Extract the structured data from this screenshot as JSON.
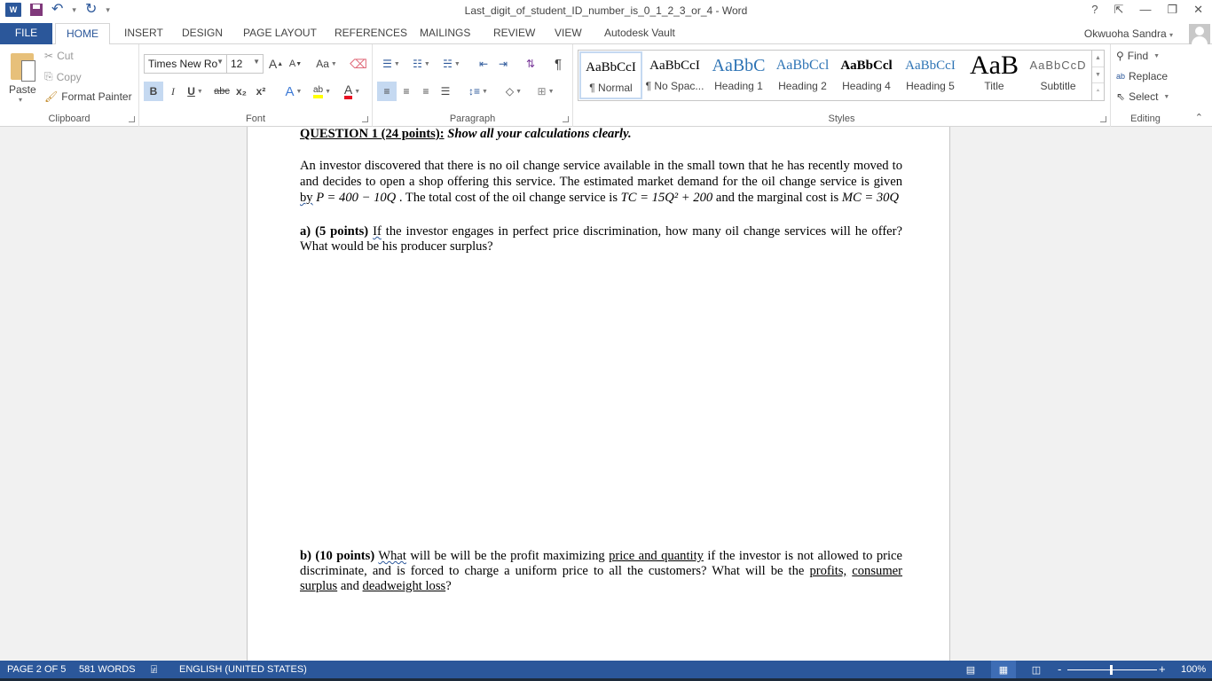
{
  "window": {
    "title": "Last_digit_of_student_ID_number_is_0_1_2_3_or_4 - Word",
    "controls": [
      "?",
      "⇱",
      "—",
      "❐",
      "✕"
    ]
  },
  "qat": {
    "undo": "↶",
    "redo": "↻",
    "customize": "⩡"
  },
  "tabs": [
    "FILE",
    "HOME",
    "INSERT",
    "DESIGN",
    "PAGE LAYOUT",
    "REFERENCES",
    "MAILINGS",
    "REVIEW",
    "VIEW",
    "Autodesk Vault"
  ],
  "active_tab": "HOME",
  "user": {
    "name": "Okwuoha Sandra"
  },
  "ribbon": {
    "clipboard": {
      "label": "Clipboard",
      "paste": "Paste",
      "cut": "Cut",
      "copy": "Copy",
      "format_painter": "Format Painter"
    },
    "font": {
      "label": "Font",
      "font_name": "Times New Ro",
      "font_size": "12",
      "grow": "A",
      "shrink": "A",
      "change_case": "Aa",
      "bold": "B",
      "italic": "I",
      "underline": "U",
      "strike": "abc",
      "subscript": "x₂",
      "superscript": "x²",
      "text_effects": "A",
      "highlight": "ab",
      "font_color": "A",
      "highlight_color": "#ffff00",
      "font_color_value": "#e81123"
    },
    "paragraph": {
      "label": "Paragraph",
      "pilcrow": "¶"
    },
    "styles": {
      "label": "Styles",
      "items": [
        {
          "preview": "AaBbCcI",
          "name": "¶ Normal",
          "selected": true
        },
        {
          "preview": "AaBbCcI",
          "name": "¶ No Spac..."
        },
        {
          "preview": "AaBbC",
          "name": "Heading 1"
        },
        {
          "preview": "AaBbCcl",
          "name": "Heading 2"
        },
        {
          "preview": "AaBbCcl",
          "name": "Heading 4"
        },
        {
          "preview": "AaBbCcI",
          "name": "Heading 5"
        },
        {
          "preview": "AaB",
          "name": "Title"
        },
        {
          "preview": "AaBbCcD",
          "name": "Subtitle"
        }
      ]
    },
    "editing": {
      "label": "Editing",
      "find": "Find",
      "replace": "Replace",
      "select": "Select"
    }
  },
  "document": {
    "question_heading": "QUESTION 1 (24 points):",
    "question_sub": " Show all your calculations clearly.",
    "intro_text": "An investor discovered that there is no oil change service available in the small town that he has recently moved to and decides to open a shop offering this service. The estimated market demand for the oil change service is given ",
    "intro_by": "by",
    "demand_eq": "P = 400 − 10Q",
    "tc_lead": " . The total cost of the oil change service is ",
    "tc_eq": "TC = 15Q² + 200",
    "mc_lead": " and the marginal cost is ",
    "mc_eq": "MC = 30Q",
    "part_a_label": "a) (5 points)",
    "part_a_if": "If",
    "part_a_text": " the investor engages in perfect price discrimination, how many oil change services will he offer? What would be his producer surplus?",
    "part_b_label": "b) (10 points)",
    "part_b_what": "What",
    "part_b_t1": " will be will be the profit maximizing ",
    "part_b_pq": "price and quantity",
    "part_b_t2": " if the investor is not allowed to price discriminate, and is forced to charge a uniform price to all the customers? What will be the ",
    "part_b_profits": "profits,",
    "part_b_space": " ",
    "part_b_cs": "consumer surplus",
    "part_b_t3": " and ",
    "part_b_dwl": "deadweight loss",
    "part_b_t4": "?"
  },
  "status": {
    "page": "PAGE 2 OF 5",
    "words": "581 WORDS",
    "language": "ENGLISH (UNITED STATES)",
    "zoom": "100%",
    "zoom_minus": "-",
    "zoom_plus": "+",
    "view_mode": "Print Layout"
  }
}
